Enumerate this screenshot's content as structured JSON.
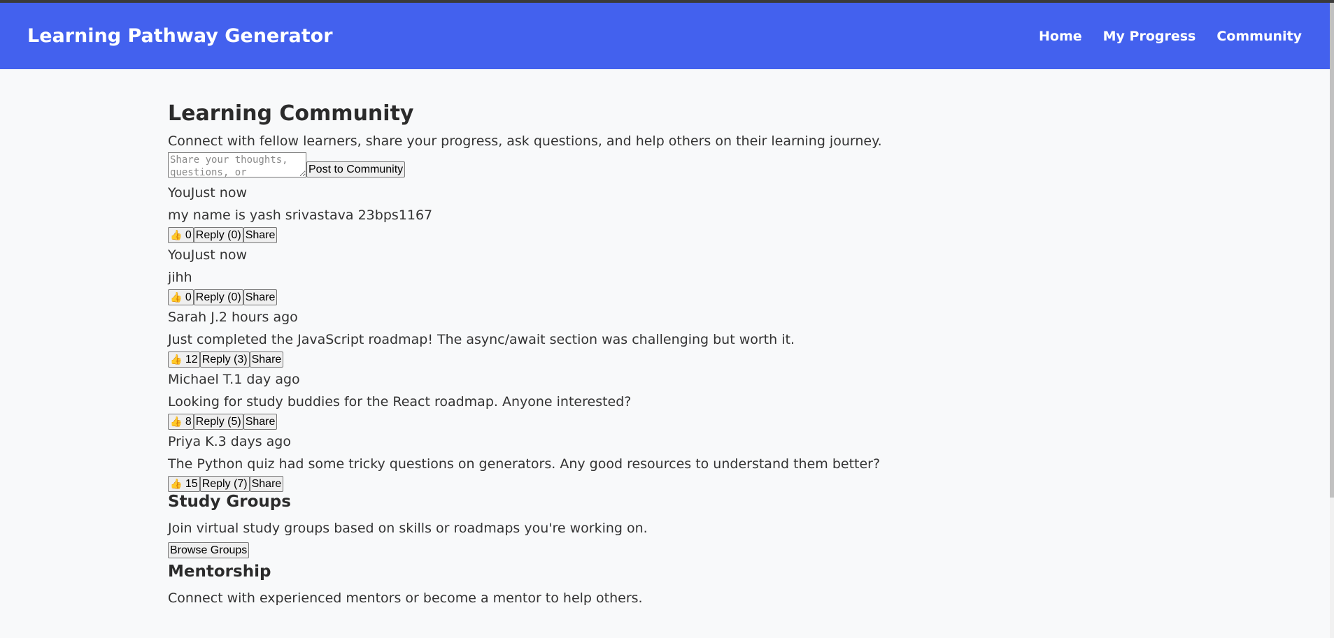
{
  "header": {
    "title": "Learning Pathway Generator",
    "nav": [
      "Home",
      "My Progress",
      "Community"
    ]
  },
  "community": {
    "heading": "Learning Community",
    "description": "Connect with fellow learners, share your progress, ask questions, and help others on their learning journey.",
    "post_placeholder": "Share your thoughts, questions, or",
    "post_button": "Post to Community",
    "posts": [
      {
        "author": "You",
        "time": "Just now",
        "content": "my name is yash srivastava 23bps1167",
        "likes": "0",
        "reply": "Reply (0)",
        "share": "Share"
      },
      {
        "author": "You",
        "time": "Just now",
        "content": "jihh",
        "likes": "0",
        "reply": "Reply (0)",
        "share": "Share"
      },
      {
        "author": "Sarah J.",
        "time": "2 hours ago",
        "content": "Just completed the JavaScript roadmap! The async/await section was challenging but worth it.",
        "likes": "12",
        "reply": "Reply (3)",
        "share": "Share"
      },
      {
        "author": "Michael T.",
        "time": "1 day ago",
        "content": "Looking for study buddies for the React roadmap. Anyone interested?",
        "likes": "8",
        "reply": "Reply (5)",
        "share": "Share"
      },
      {
        "author": "Priya K.",
        "time": "3 days ago",
        "content": "The Python quiz had some tricky questions on generators. Any good resources to understand them better?",
        "likes": "15",
        "reply": "Reply (7)",
        "share": "Share"
      }
    ]
  },
  "study_groups": {
    "heading": "Study Groups",
    "description": "Join virtual study groups based on skills or roadmaps you're working on.",
    "button": "Browse Groups"
  },
  "mentorship": {
    "heading": "Mentorship",
    "description": "Connect with experienced mentors or become a mentor to help others."
  },
  "icons": {
    "like": "thumbs-up-icon"
  },
  "colors": {
    "header_bg": "#4361ee",
    "page_bg": "#f8f9fa"
  }
}
